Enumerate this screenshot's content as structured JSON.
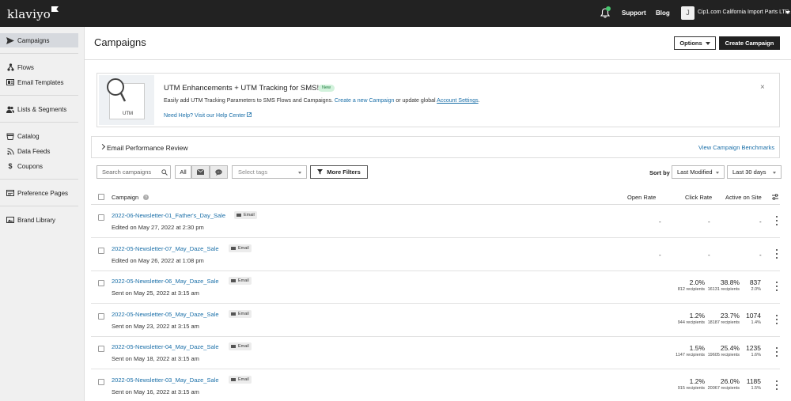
{
  "topbar": {
    "logo": "klaviyo",
    "support": "Support",
    "blog": "Blog",
    "avatar_initial": "J",
    "account_name": "Cip1.com California Import Parts LTD.",
    "notification_count": "1"
  },
  "sidebar": {
    "items": [
      {
        "label": "Campaigns",
        "icon": "send-icon"
      },
      {
        "label": "Flows",
        "icon": "flow-icon"
      },
      {
        "label": "Email Templates",
        "icon": "template-icon"
      },
      {
        "label": "Lists & Segments",
        "icon": "people-icon"
      },
      {
        "label": "Catalog",
        "icon": "catalog-icon"
      },
      {
        "label": "Data Feeds",
        "icon": "rss-icon"
      },
      {
        "label": "Coupons",
        "icon": "dollar-icon"
      },
      {
        "label": "Preference Pages",
        "icon": "page-icon"
      },
      {
        "label": "Brand Library",
        "icon": "image-icon"
      }
    ]
  },
  "header": {
    "title": "Campaigns",
    "options_label": "Options",
    "create_label": "Create Campaign"
  },
  "banner": {
    "art_label": "UTM",
    "title": "UTM Enhancements + UTM Tracking for SMS!",
    "badge": "New",
    "text_before": "Easily add UTM Tracking Parameters to SMS Flows and Campaigns.",
    "link1": "Create a new Campaign",
    "text_middle": "or update global",
    "link2": "Account Settings",
    "text_after": ".",
    "help": "Need Help? Visit our Help Center",
    "close": "×"
  },
  "review": {
    "title": "Email Performance Review",
    "link": "View Campaign Benchmarks"
  },
  "filters": {
    "search_placeholder": "Search campaigns",
    "type_all": "All",
    "tags_placeholder": "Select tags",
    "more_filters": "More Filters",
    "sort_by_label": "Sort by",
    "sort_value": "Last Modified",
    "range_value": "Last 30 days"
  },
  "table": {
    "headers": {
      "campaign": "Campaign",
      "open_rate": "Open Rate",
      "click_rate": "Click Rate",
      "active_on_site": "Active on Site"
    },
    "rows": [
      {
        "name": "2022-06-Newsletter-01_Father's_Day_Sale",
        "tag": "Email",
        "status": "Edited",
        "date": "on May 27, 2022 at 2:30 pm",
        "open_rate": "-",
        "open_recipients": "",
        "click_rate": "-",
        "click_recipients": "",
        "active": "-",
        "active_pct": ""
      },
      {
        "name": "2022-05-Newsletter-07_May_Daze_Sale",
        "tag": "Email",
        "status": "Edited",
        "date": "on May 26, 2022 at 1:08 pm",
        "open_rate": "-",
        "open_recipients": "",
        "click_rate": "-",
        "click_recipients": "",
        "active": "-",
        "active_pct": ""
      },
      {
        "name": "2022-05-Newsletter-06_May_Daze_Sale",
        "tag": "Email",
        "status": "Sent",
        "date": "on May 25, 2022 at 3:15 am",
        "open_rate": "38.8%",
        "open_recipients": "16131 recipients",
        "click_rate": "2.0%",
        "click_recipients": "812 recipients",
        "active": "837",
        "active_pct": "2.0%"
      },
      {
        "name": "2022-05-Newsletter-05_May_Daze_Sale",
        "tag": "Email",
        "status": "Sent",
        "date": "on May 23, 2022 at 3:15 am",
        "open_rate": "23.7%",
        "open_recipients": "18187 recipients",
        "click_rate": "1.2%",
        "click_recipients": "944 recipients",
        "active": "1074",
        "active_pct": "1.4%"
      },
      {
        "name": "2022-05-Newsletter-04_May_Daze_Sale",
        "tag": "Email",
        "status": "Sent",
        "date": "on May 18, 2022 at 3:15 am",
        "open_rate": "25.4%",
        "open_recipients": "19605 recipients",
        "click_rate": "1.5%",
        "click_recipients": "1147 recipients",
        "active": "1235",
        "active_pct": "1.6%"
      },
      {
        "name": "2022-05-Newsletter-03_May_Daze_Sale",
        "tag": "Email",
        "status": "Sent",
        "date": "on May 16, 2022 at 3:15 am",
        "open_rate": "26.0%",
        "open_recipients": "20067 recipients",
        "click_rate": "1.2%",
        "click_recipients": "915 recipients",
        "active": "1185",
        "active_pct": "1.5%"
      }
    ]
  }
}
